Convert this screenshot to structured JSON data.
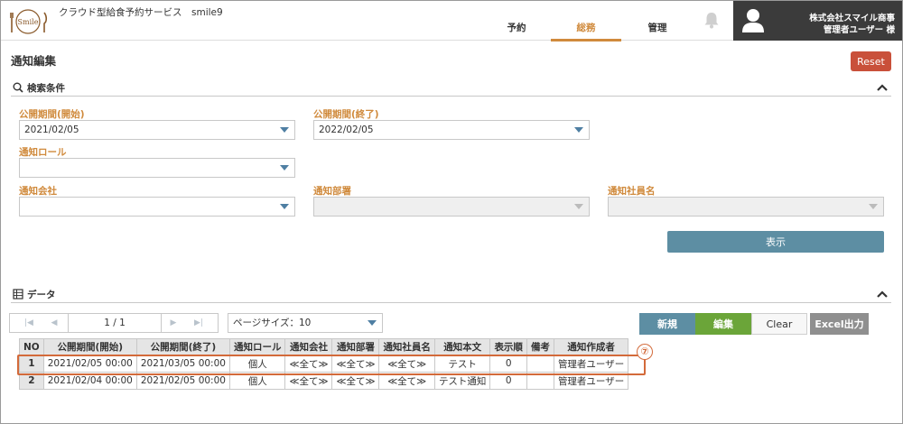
{
  "header": {
    "app_title": "クラウド型給食予約サービス　smile9",
    "logo_text": "Smile",
    "tabs": [
      {
        "label": "予約",
        "active": false
      },
      {
        "label": "総務",
        "active": true
      },
      {
        "label": "管理",
        "active": false
      }
    ],
    "company": "株式会社スマイル商事",
    "user": "管理者ユーザー 様"
  },
  "page_title": "通知編集",
  "reset_label": "Reset",
  "search": {
    "title": "検索条件",
    "fields": {
      "start_label": "公開期間(開始)",
      "start_value": "2021/02/05",
      "end_label": "公開期間(終了)",
      "end_value": "2022/02/05",
      "role_label": "通知ロール",
      "role_value": "",
      "company_label": "通知会社",
      "company_value": "",
      "dept_label": "通知部署",
      "dept_value": "",
      "employee_label": "通知社員名",
      "employee_value": ""
    },
    "show_label": "表示"
  },
  "data_section": {
    "title": "データ",
    "pager_info": "1 / 1",
    "page_size": "ページサイズ：10",
    "buttons": {
      "new": "新規",
      "edit": "編集",
      "clear": "Clear",
      "excel": "Excel出力"
    }
  },
  "table": {
    "headers": [
      "NO",
      "公開期間(開始)",
      "公開期間(終了)",
      "通知ロール",
      "通知会社",
      "通知部署",
      "通知社員名",
      "通知本文",
      "表示順",
      "備考",
      "通知作成者"
    ],
    "rows": [
      [
        "1",
        "2021/02/05 00:00",
        "2021/03/05 00:00",
        "個人",
        "≪全て≫",
        "≪全て≫",
        "≪全て≫",
        "テスト",
        "0",
        "",
        "管理者ユーザー"
      ],
      [
        "2",
        "2021/02/04 00:00",
        "2021/02/05 00:00",
        "個人",
        "≪全て≫",
        "≪全て≫",
        "≪全て≫",
        "テスト通知",
        "0",
        "",
        "管理者ユーザー"
      ]
    ]
  },
  "annotation_marker": "⑦",
  "colors": {
    "accent": "#d08a3c",
    "reset": "#c9503a",
    "show": "#5d8ea3",
    "new": "#5d8ea3",
    "edit": "#6ba539",
    "excel": "#8f8f8f",
    "highlight": "#d36a3a"
  }
}
